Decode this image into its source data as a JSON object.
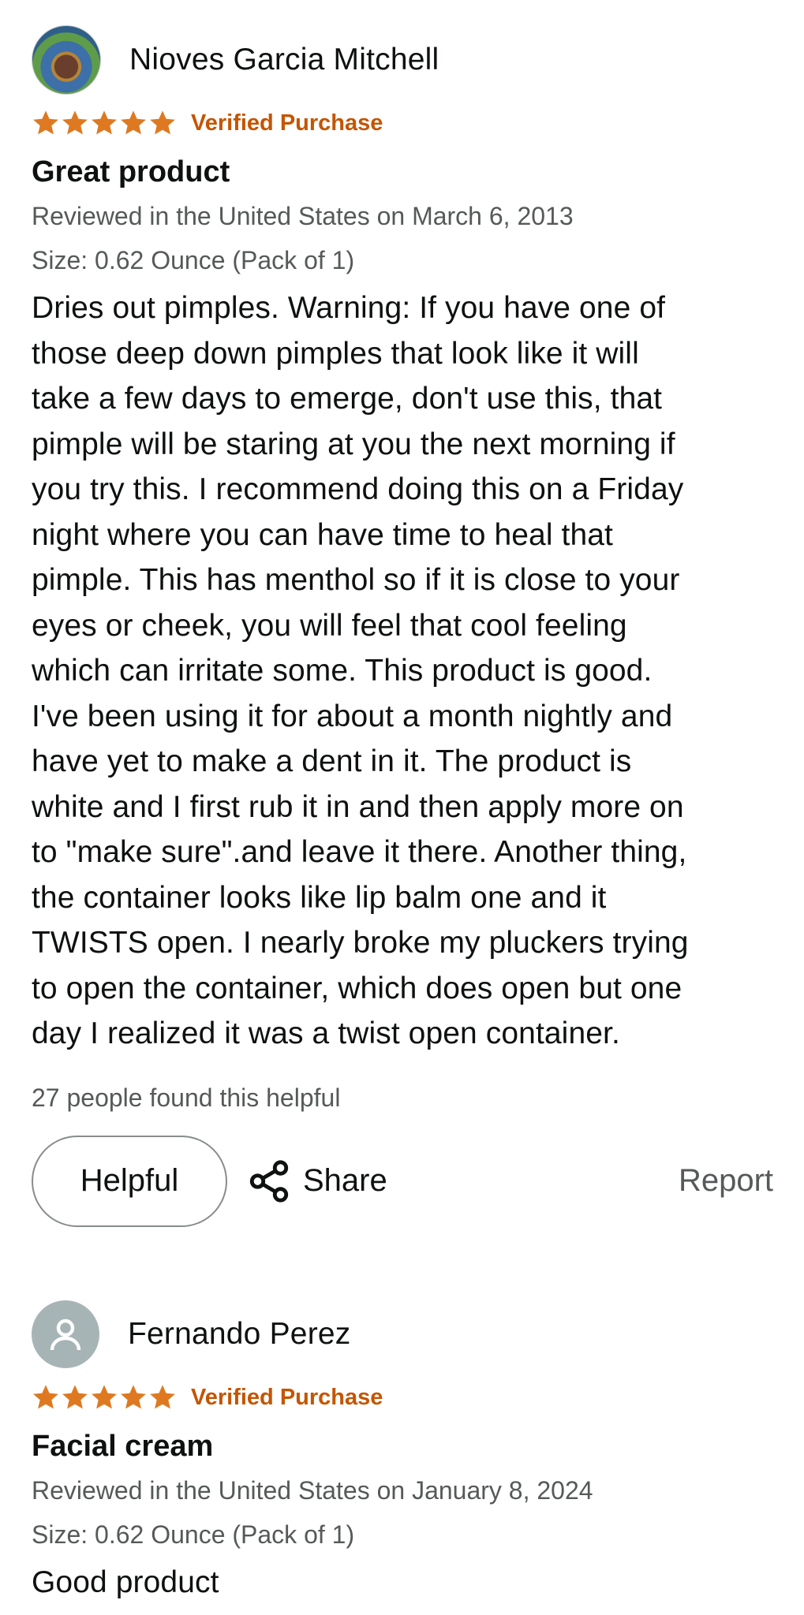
{
  "reviews": [
    {
      "reviewer_name": "Nioves Garcia Mitchell",
      "avatar_type": "photo",
      "rating": 5,
      "verified_label": "Verified Purchase",
      "title": "Great product",
      "reviewed_line": "Reviewed in the United States on March 6, 2013",
      "size_line": "Size: 0.62 Ounce (Pack of 1)",
      "body_lines": [
        "Dries out pimples. Warning: If you have one of",
        "those deep down pimples that look like it will",
        "take a few days to emerge, don't use this, that",
        "pimple will be staring at you the next morning if",
        "you try this. I recommend doing this on a Friday",
        "night where you can have time to heal that",
        "pimple. This has menthol so if it is close to your",
        "eyes or cheek, you will feel that cool feeling",
        "which can irritate some. This product is good.",
        "I've been using it for about a month nightly and",
        "have yet to make a dent in it. The product is",
        "white and I first rub it in and then apply more on",
        "to \"make sure\".and leave it there. Another thing,",
        "the container looks like lip balm one and it",
        "TWISTS open. I nearly broke my pluckers trying",
        "to open the container, which does open but one",
        "day I realized it was a twist open container."
      ],
      "helpful_count": "27 people found this helpful",
      "helpful_label": "Helpful",
      "share_label": "Share",
      "report_label": "Report"
    },
    {
      "reviewer_name": "Fernando Perez",
      "avatar_type": "generic",
      "rating": 5,
      "verified_label": "Verified Purchase",
      "title": "Facial cream",
      "reviewed_line": "Reviewed in the United States on January 8, 2024",
      "size_line": "Size: 0.62 Ounce (Pack of 1)",
      "body_lines": [
        "Good product"
      ]
    }
  ],
  "icons": {
    "star": "star-icon",
    "share": "share-icon",
    "avatar_generic": "person-icon"
  },
  "colors": {
    "star": "#de7921",
    "verified": "#c45500",
    "secondary_text": "#565959",
    "primary_text": "#0f1111",
    "button_border": "#888c8c"
  }
}
